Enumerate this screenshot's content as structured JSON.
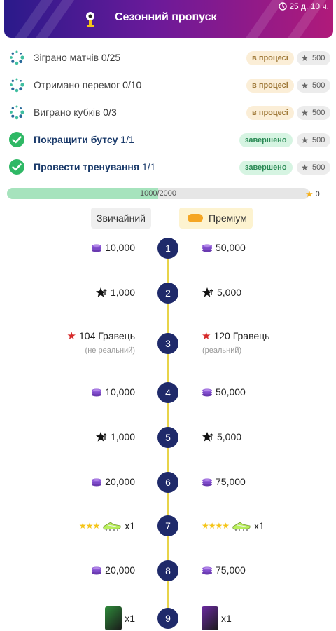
{
  "header": {
    "title": "Сезонний пропуск",
    "timer": "25 д. 10 ч."
  },
  "tasks": [
    {
      "name": "Зіграно матчів",
      "progress": "0/25",
      "status": "в процесі",
      "reward": "500",
      "done": false
    },
    {
      "name": "Отримано перемог",
      "progress": "0/10",
      "status": "в процесі",
      "reward": "500",
      "done": false
    },
    {
      "name": "Виграно кубків",
      "progress": "0/3",
      "status": "в процесі",
      "reward": "500",
      "done": false
    },
    {
      "name": "Покращити бутсу",
      "progress": "1/1",
      "status": "завершено",
      "reward": "500",
      "done": true
    },
    {
      "name": "Провести тренування",
      "progress": "1/1",
      "status": "завершено",
      "reward": "500",
      "done": true
    }
  ],
  "progress": {
    "text": "1000/2000",
    "fraction": 0.5,
    "stars": "0"
  },
  "tabs": {
    "normal": "Звичайний",
    "premium": "Преміум"
  },
  "levels": [
    {
      "n": "1",
      "left": {
        "kind": "coins",
        "text": "10,000"
      },
      "right": {
        "kind": "coins",
        "text": "50,000"
      }
    },
    {
      "n": "2",
      "left": {
        "kind": "stars",
        "text": "1,000"
      },
      "right": {
        "kind": "stars",
        "text": "5,000"
      }
    },
    {
      "n": "3",
      "left": {
        "kind": "player",
        "text": "104 Гравець",
        "sub": "(не реальний)"
      },
      "right": {
        "kind": "player",
        "text": "120 Гравець",
        "sub": "(реальний)"
      }
    },
    {
      "n": "4",
      "left": {
        "kind": "coins",
        "text": "10,000"
      },
      "right": {
        "kind": "coins",
        "text": "50,000"
      }
    },
    {
      "n": "5",
      "left": {
        "kind": "stars",
        "text": "1,000"
      },
      "right": {
        "kind": "stars",
        "text": "5,000"
      }
    },
    {
      "n": "6",
      "left": {
        "kind": "coins",
        "text": "20,000"
      },
      "right": {
        "kind": "coins",
        "text": "75,000"
      }
    },
    {
      "n": "7",
      "left": {
        "kind": "boot",
        "text": "x1",
        "stars": "★★★"
      },
      "right": {
        "kind": "boot",
        "text": "x1",
        "stars": "★★★★"
      }
    },
    {
      "n": "8",
      "left": {
        "kind": "coins",
        "text": "20,000"
      },
      "right": {
        "kind": "coins",
        "text": "75,000"
      }
    },
    {
      "n": "9",
      "left": {
        "kind": "card",
        "text": "x1",
        "color": "#2e8a3a"
      },
      "right": {
        "kind": "card",
        "text": "x1",
        "color": "#6a2aa0"
      }
    }
  ],
  "colors": {
    "header_start": "#2a1a8a",
    "header_end": "#b01a7a",
    "level_badge": "#1f2a6a",
    "track_line": "#e8d44a",
    "progress_fill": "#a6e3bd"
  }
}
